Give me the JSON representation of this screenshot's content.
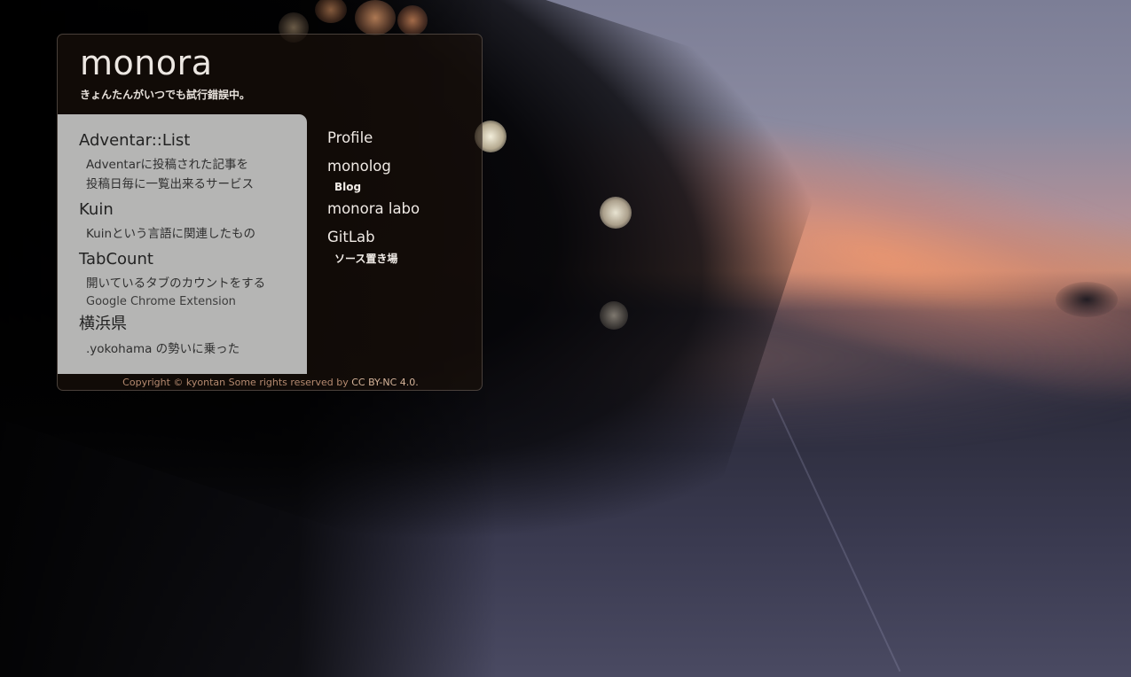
{
  "site": {
    "title": "monora",
    "subtitle": "きょんたんがいつでも試行錯誤中。"
  },
  "projects": [
    {
      "title": "Adventar::List",
      "desc": [
        "Adventarに投稿された記事を",
        "投稿日毎に一覧出来るサービス"
      ]
    },
    {
      "title": "Kuin",
      "desc": [
        "Kuinという言語に関連したもの"
      ]
    },
    {
      "title": "TabCount",
      "desc": [
        "開いているタブのカウントをする",
        "Google Chrome Extension"
      ]
    },
    {
      "title": "横浜県",
      "desc": [
        ".yokohama の勢いに乗った"
      ]
    }
  ],
  "nav": [
    {
      "label": "Profile"
    },
    {
      "label": "monolog",
      "sub": "Blog"
    },
    {
      "label": "monora labo"
    },
    {
      "label": "GitLab",
      "sub": "ソース置き場"
    }
  ],
  "footer": {
    "text": "Copyright © kyontan Some rights reserved by",
    "license": "CC BY-NC 4.0."
  },
  "colors": {
    "panel_bg": "#1c120c",
    "card_bg": "#c8c8c8",
    "footer_text": "#b58a70",
    "license_link": "#d6b49a"
  }
}
